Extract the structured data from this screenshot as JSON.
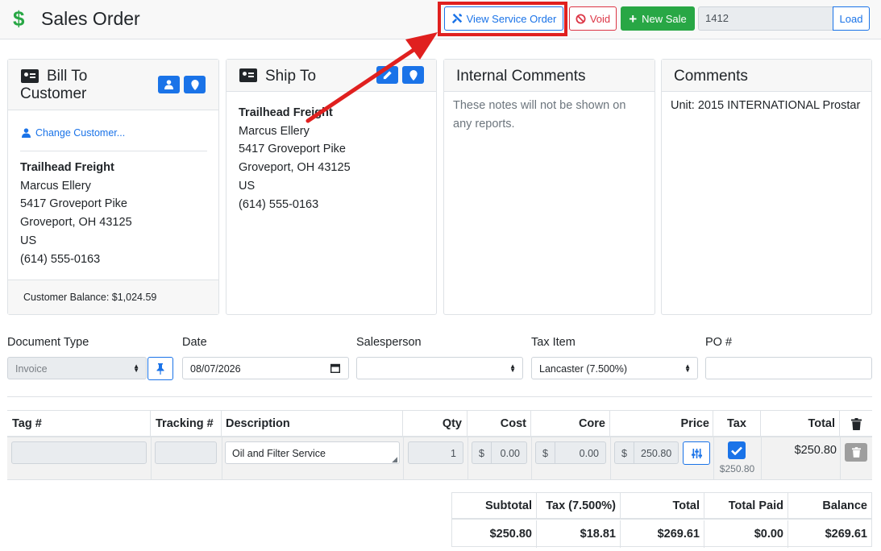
{
  "header": {
    "title": "Sales Order",
    "view_service_order": "View Service Order",
    "void": "Void",
    "new_sale": "New Sale",
    "load_value": "1412",
    "load": "Load"
  },
  "bill_to": {
    "title_line1": "Bill To",
    "title_line2": "Customer",
    "change_customer": "Change Customer...",
    "company": "Trailhead Freight",
    "contact": "Marcus Ellery",
    "street": "5417 Groveport Pike",
    "city_state_zip": "Groveport, OH 43125",
    "country": "US",
    "phone": "(614) 555-0163",
    "balance": "Customer Balance: $1,024.59"
  },
  "ship_to": {
    "title": "Ship To",
    "company": "Trailhead Freight",
    "contact": "Marcus Ellery",
    "street": "5417 Groveport Pike",
    "city_state_zip": "Groveport, OH 43125",
    "country": "US",
    "phone": "(614) 555-0163"
  },
  "internal_comments": {
    "title": "Internal Comments",
    "placeholder": "These notes will not be shown on any reports."
  },
  "comments": {
    "title": "Comments",
    "text": "Unit: 2015 INTERNATIONAL Prostar"
  },
  "form": {
    "document_type_label": "Document Type",
    "document_type_value": "Invoice",
    "date_label": "Date",
    "date_value": "08/07/2026",
    "salesperson_label": "Salesperson",
    "salesperson_value": "",
    "tax_item_label": "Tax Item",
    "tax_item_value": "Lancaster (7.500%)",
    "po_label": "PO #",
    "po_value": ""
  },
  "items": {
    "columns": [
      "Tag #",
      "Tracking #",
      "Description",
      "Qty",
      "Cost",
      "Core",
      "Price",
      "Tax",
      "Total"
    ],
    "rows": [
      {
        "tag": "",
        "tracking": "",
        "description": "Oil and Filter Service",
        "qty": "1",
        "cost_symbol": "$",
        "cost": "0.00",
        "core_symbol": "$",
        "core": "0.00",
        "price_symbol": "$",
        "price": "250.80",
        "tax_checked": true,
        "tax_amount": "$250.80",
        "total": "$250.80"
      }
    ]
  },
  "totals": {
    "headers": [
      "Subtotal",
      "Tax (7.500%)",
      "Total",
      "Total Paid",
      "Balance"
    ],
    "values": [
      "$250.80",
      "$18.81",
      "$269.61",
      "$0.00",
      "$269.61"
    ]
  },
  "colors": {
    "primary": "#1a73e8",
    "success": "#28a745",
    "danger": "#dc3545",
    "annotation": "#e0201f"
  }
}
